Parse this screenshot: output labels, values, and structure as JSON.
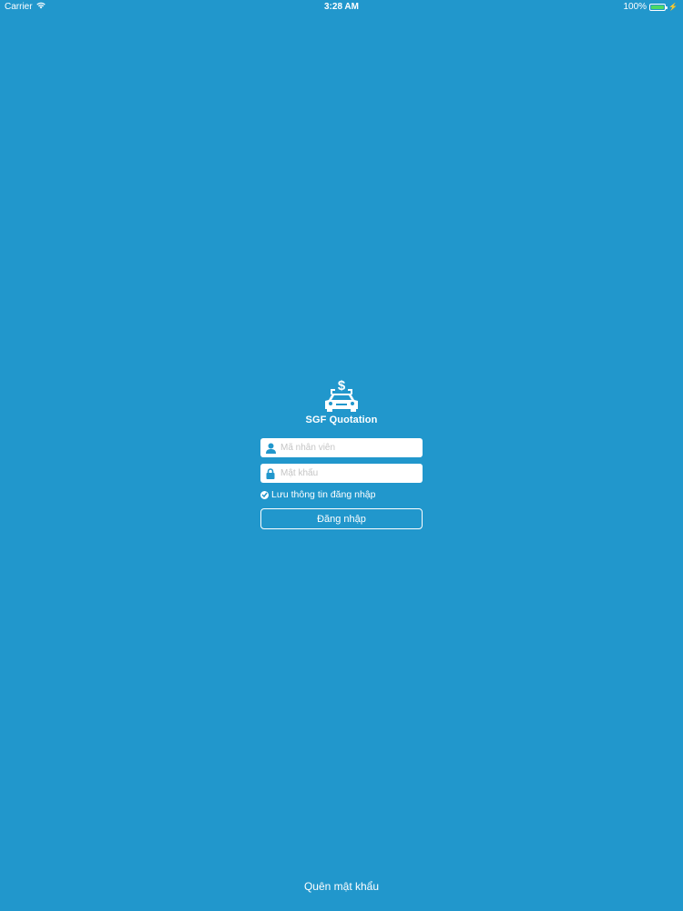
{
  "status_bar": {
    "carrier": "Carrier",
    "time": "3:28 AM",
    "battery_percent": "100%",
    "battery_level": 1.0,
    "battery_color": "#4cd964"
  },
  "app": {
    "name": "SGF Quotation",
    "logo_icon": "car-dollar-icon",
    "background_color": "#2197cc"
  },
  "login_form": {
    "employee_id": {
      "placeholder": "Mã nhân viên",
      "value": "",
      "icon": "user-icon"
    },
    "password": {
      "placeholder": "Mật khẩu",
      "value": "",
      "icon": "lock-icon"
    },
    "remember": {
      "label": "Lưu thông tin đăng nhập",
      "checked": true,
      "icon": "check-circle-icon"
    },
    "login_label": "Đăng nhập"
  },
  "footer": {
    "forgot_password": "Quên mật khẩu"
  }
}
